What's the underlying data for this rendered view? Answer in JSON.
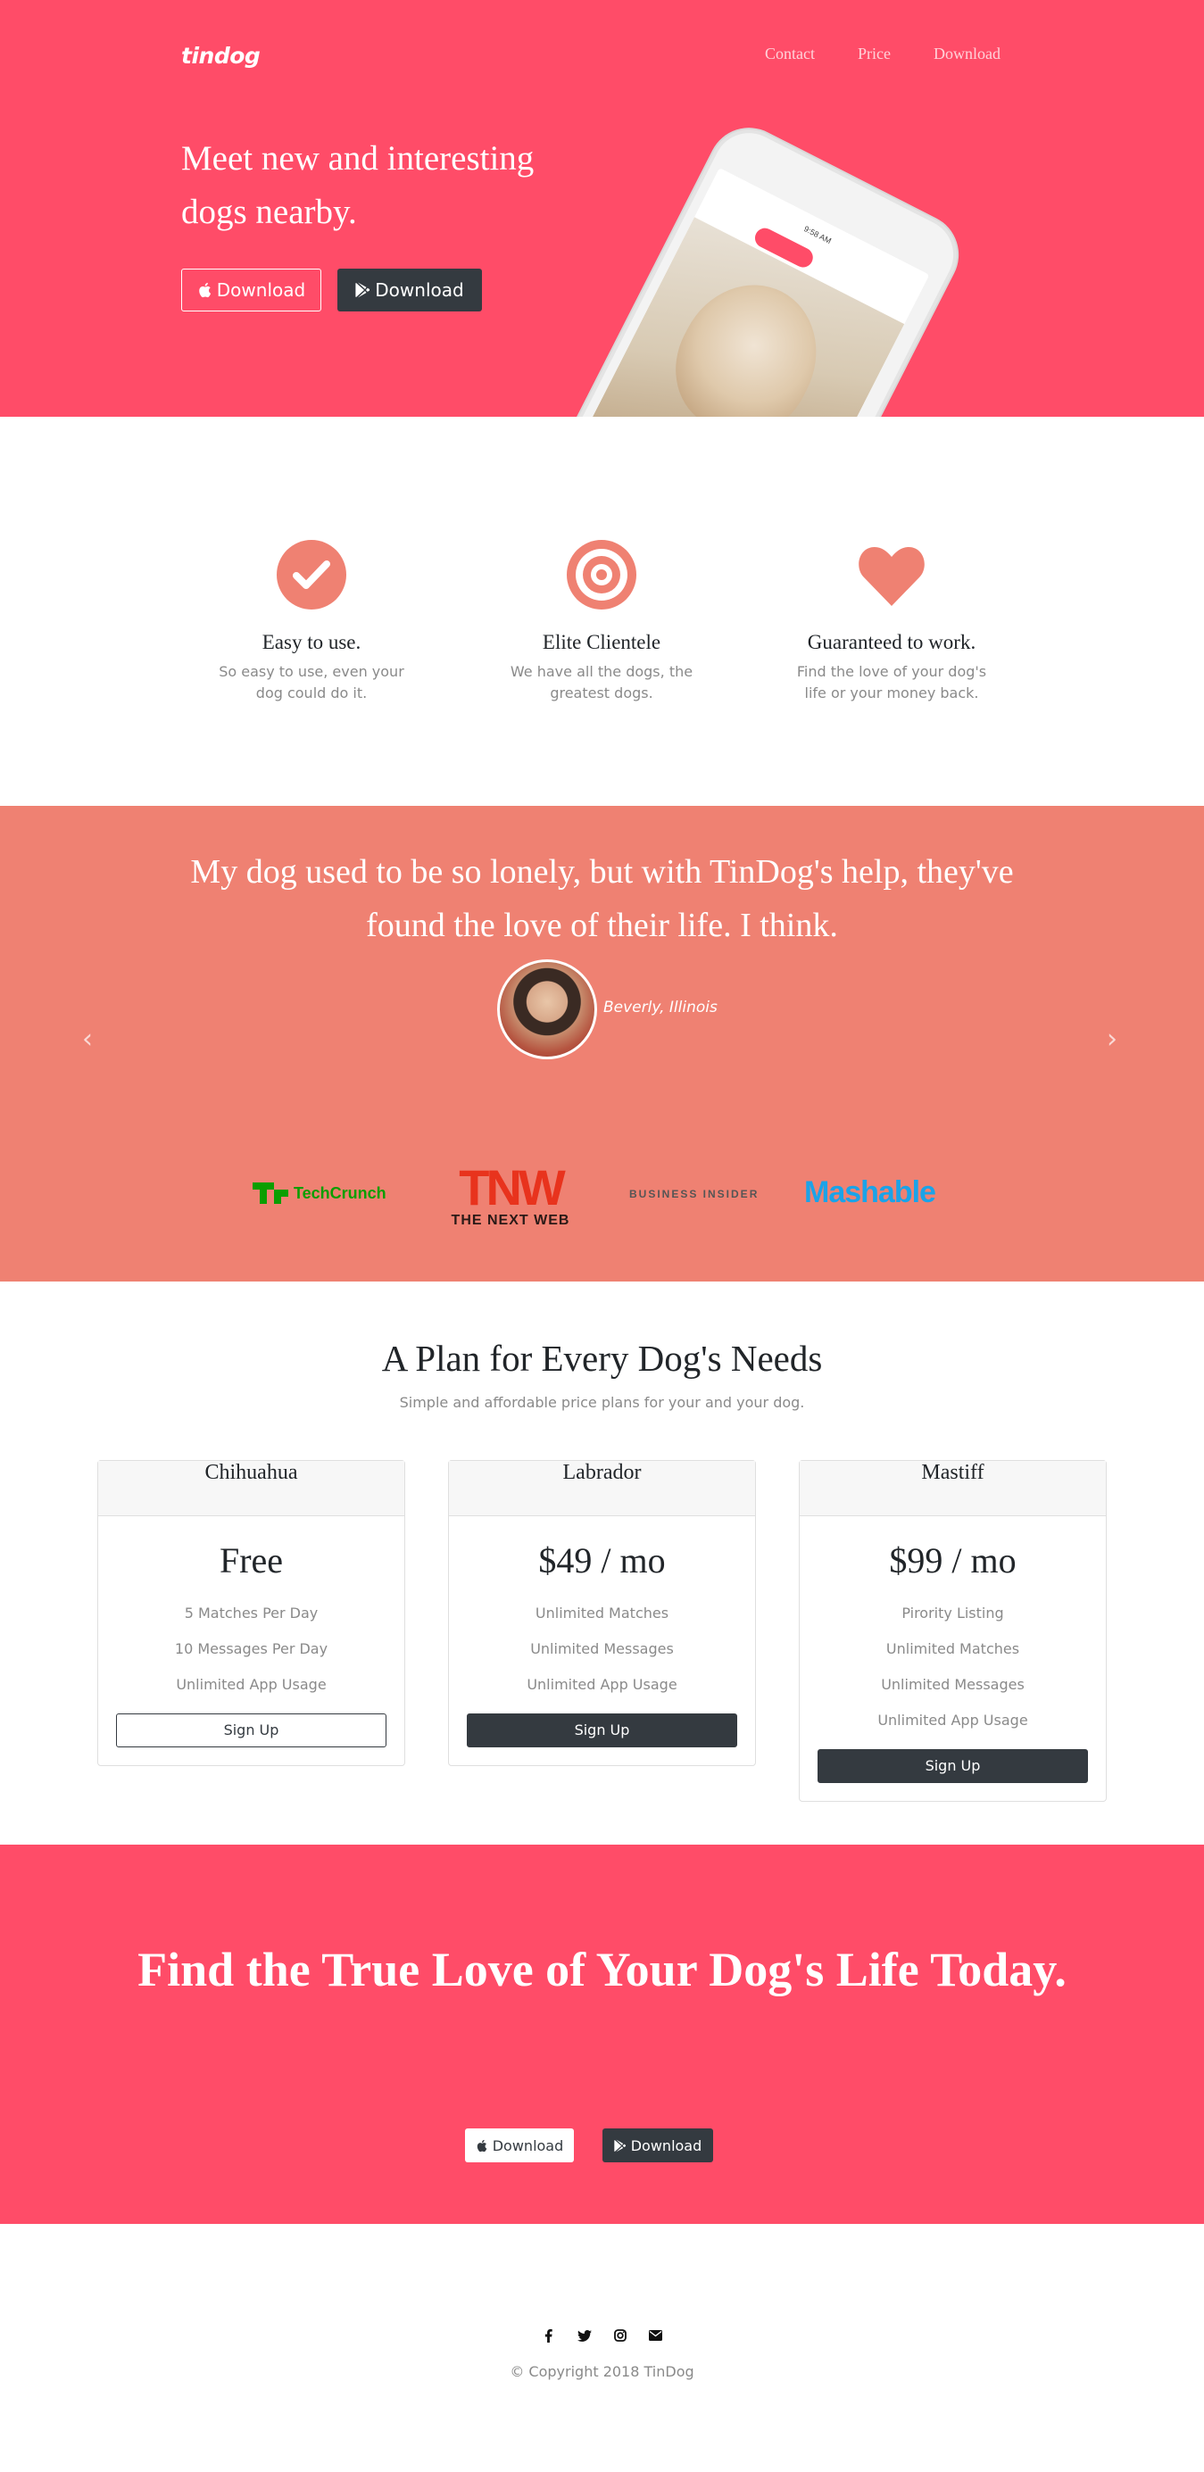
{
  "brand": "tindog",
  "nav": {
    "contact": "Contact",
    "price": "Price",
    "download": "Download"
  },
  "hero": {
    "title": "Meet new and interesting dogs nearby.",
    "apple_btn": "Download",
    "play_btn": "Download"
  },
  "features": [
    {
      "icon": "check-circle-icon",
      "title": "Easy to use.",
      "text": "So easy to use, even your dog could do it."
    },
    {
      "icon": "bullseye-icon",
      "title": "Elite Clientele",
      "text": "We have all the dogs, the greatest dogs."
    },
    {
      "icon": "heart-icon",
      "title": "Guaranteed to work.",
      "text": "Find the love of your dog's life or your money back."
    }
  ],
  "testimonial": {
    "quote": "My dog used to be so lonely, but with TinDog's help, they've found the love of their life. I think.",
    "author": "Beverly, Illinois"
  },
  "press": {
    "techcrunch": "TechCrunch",
    "tnw_big": "TNW",
    "tnw_small": "THE NEXT WEB",
    "business_insider": "BUSINESS INSIDER",
    "mashable": "Mashable"
  },
  "pricing": {
    "title": "A Plan for Every Dog's Needs",
    "subtitle": "Simple and affordable price plans for your and your dog.",
    "plans": [
      {
        "name": "Chihuahua",
        "price": "Free",
        "features": [
          "5 Matches Per Day",
          "10 Messages Per Day",
          "Unlimited App Usage"
        ],
        "button": "Sign Up"
      },
      {
        "name": "Labrador",
        "price": "$49 / mo",
        "features": [
          "Unlimited Matches",
          "Unlimited Messages",
          "Unlimited App Usage"
        ],
        "button": "Sign Up"
      },
      {
        "name": "Mastiff",
        "price": "$99 / mo",
        "features": [
          "Pirority Listing",
          "Unlimited Matches",
          "Unlimited Messages",
          "Unlimited App Usage"
        ],
        "button": "Sign Up"
      }
    ]
  },
  "cta": {
    "title": "Find the True Love of Your Dog's Life Today.",
    "apple_btn": "Download",
    "play_btn": "Download"
  },
  "footer": {
    "copyright": "© Copyright 2018 TinDog",
    "socials": [
      "facebook-icon",
      "twitter-icon",
      "instagram-icon",
      "envelope-icon"
    ]
  },
  "colors": {
    "primary": "#ff4c68",
    "salmon": "#ef8172",
    "dark": "#343a40"
  }
}
